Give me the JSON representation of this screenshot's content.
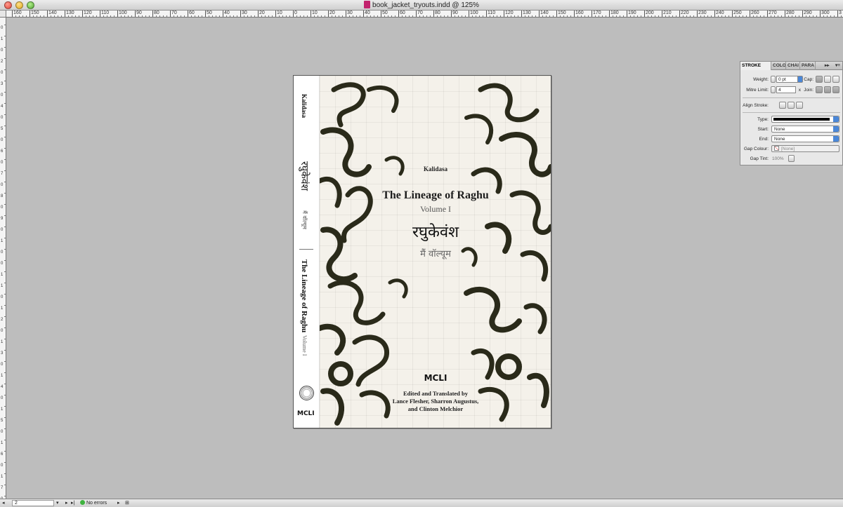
{
  "window": {
    "title": "book_jacket_tryouts.indd @ 125%"
  },
  "ruler": {
    "top_labels": [
      "160",
      "150",
      "140",
      "130",
      "120",
      "110",
      "100",
      "90",
      "80",
      "70",
      "60",
      "50",
      "40",
      "30",
      "20",
      "10",
      "0",
      "10",
      "20",
      "30",
      "40",
      "50",
      "60",
      "70",
      "80",
      "90",
      "100",
      "110",
      "120",
      "130",
      "140",
      "150",
      "160",
      "170",
      "180",
      "190",
      "200",
      "210",
      "220",
      "230",
      "240",
      "250",
      "260",
      "270",
      "280",
      "290",
      "300",
      "3"
    ],
    "left_labels": [
      "0",
      "1",
      "0",
      "2",
      "0",
      "3",
      "0",
      "4",
      "0",
      "5",
      "0",
      "6",
      "0",
      "7",
      "0",
      "8",
      "0",
      "9",
      "0",
      "1",
      "0",
      "0",
      "1",
      "1",
      "0",
      "1",
      "2",
      "0",
      "1",
      "3",
      "0",
      "1",
      "4",
      "0",
      "1",
      "5",
      "0",
      "1",
      "6",
      "0",
      "1",
      "7",
      "0"
    ]
  },
  "spine": {
    "author": "Kalidasa",
    "devanagari_title": "रघुकेवंश",
    "devanagari_volume": "मैं वॉल्यूम",
    "title": "The Lineage of Raghu",
    "volume": "Volume I",
    "logo": "MCLI"
  },
  "cover": {
    "author": "Kalidasa",
    "title": "The Lineage of Raghu",
    "volume": "Volume I",
    "devanagari_title": "रघुकेवंश",
    "devanagari_volume": "मैं वॉल्यूम",
    "logo": "MCLI",
    "credits": [
      "Edited and Translated by",
      "Lance Flesher, Sharron Augustus,",
      "and Clinton Melchior"
    ]
  },
  "stroke_panel": {
    "tabs": [
      "STROKE",
      "COLO",
      "CHAI",
      "PARA"
    ],
    "weight_label": "Weight:",
    "weight_value": "0 pt",
    "cap_label": "Cap:",
    "mitre_label": "Mitre Limit:",
    "mitre_value": "4",
    "mitre_unit": "x",
    "join_label": "Join:",
    "align_label": "Align Stroke:",
    "type_label": "Type:",
    "start_label": "Start:",
    "start_value": "None",
    "end_label": "End:",
    "end_value": "None",
    "gap_colour_label": "Gap Colour:",
    "gap_colour_value": "[None]",
    "gap_tint_label": "Gap Tint:",
    "gap_tint_value": "100%"
  },
  "status": {
    "page_number": "2",
    "preflight": "No errors"
  },
  "colors": {
    "canvas": "#bdbdbd",
    "page": "#f4f1ea",
    "ink": "#2a2a1a",
    "accent": "#4a87d8"
  }
}
